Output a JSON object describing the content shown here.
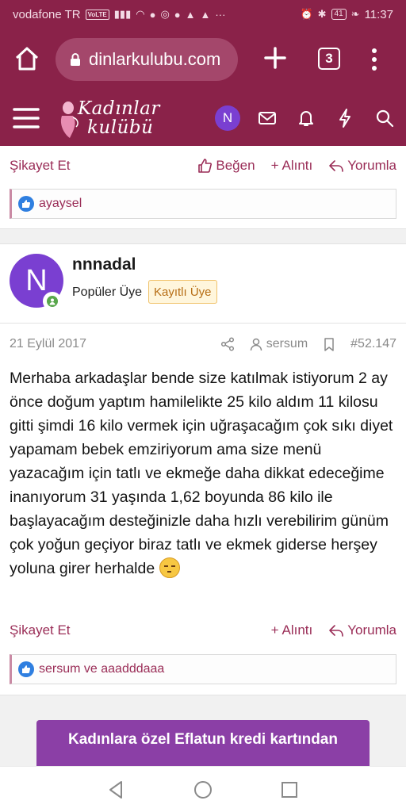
{
  "status_bar": {
    "carrier": "vodafone TR",
    "volte": "VoLTE",
    "battery": "41",
    "time": "11:37"
  },
  "browser": {
    "url": "dinlarkulubu.com",
    "tab_count": "3"
  },
  "site": {
    "logo_line1": "Kadınlar",
    "logo_line2": "kulübü",
    "user_initial": "N"
  },
  "prev_post": {
    "report_label": "Şikayet Et",
    "like_label": "Beğen",
    "quote_label": "Alıntı",
    "reply_label": "Yorumla",
    "reactions": "ayaysel"
  },
  "post": {
    "avatar_initial": "N",
    "username": "nnnadal",
    "user_title": "Popüler Üye",
    "badge": "Kayıtlı Üye",
    "date": "21 Eylül 2017",
    "author_ref": "sersum",
    "post_number": "#52.147",
    "message": "Merhaba arkadaşlar bende size katılmak istiyorum 2 ay önce doğum yaptım hamilelikte 25 kilo aldım 11 kilosu gitti şimdi 16 kilo vermek için uğraşacağım çok sıkı diyet yapamam bebek emziriyorum ama size menü yazacağım için tatlı ve ekmeğe daha dikkat edeceğime inanıyorum 31 yaşında 1,62 boyunda 86 kilo ile başlayacağım desteğinizle daha hızlı verebilirim günüm çok yoğun geçiyor biraz tatlı ve ekmek giderse herşey yoluna girer herhalde",
    "report_label": "Şikayet Et",
    "quote_label": "Alıntı",
    "reply_label": "Yorumla",
    "reactions": "sersum ve aaadddaaa"
  },
  "ad": {
    "text": "Kadınlara özel Eflatun kredi kartından"
  },
  "colors": {
    "brand": "#8a2249",
    "link": "#9a2d57",
    "avatar": "#7a3fd1",
    "ad": "#8b3fa6"
  }
}
